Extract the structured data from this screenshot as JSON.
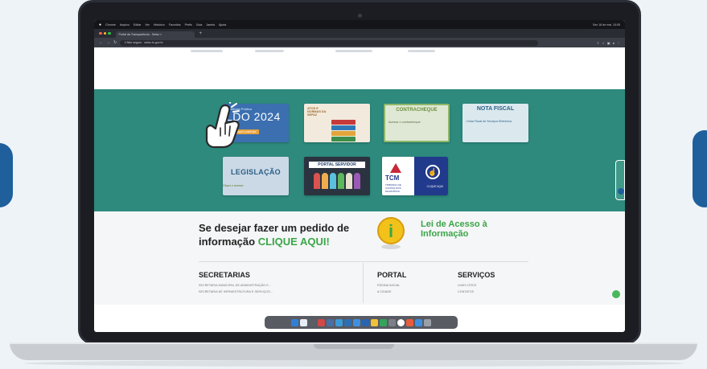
{
  "menubar": {
    "items": [
      "Chrome",
      "Arquivo",
      "Editar",
      "Ver",
      "Histórico",
      "Favoritos",
      "Perfis",
      "Guia",
      "Janela",
      "Ajuda"
    ],
    "clock": "Sex 18 de mai. 10:05"
  },
  "tab": {
    "title": "Portal da Transparência - Sefaz",
    "close": "×"
  },
  "toolbar": {
    "url": "ℹ Não seguro · sefaz.to.gov.br",
    "back": "←",
    "forward": "→",
    "reload": "↻"
  },
  "banners": {
    "ldo": {
      "small": "Audiência Pública",
      "big": "LDO 2024",
      "tag": "Clique aqui e participe"
    },
    "books": {
      "label": "ATOS E NORMAS DA SEFAZ"
    },
    "contracheque": {
      "title": "CONTRACHEQUE",
      "subtitle": "Acesse o contracheque"
    },
    "nota": {
      "title": "NOTA FISCAL",
      "subtitle": "• Nota Fiscal de Serviços Eletrônica"
    },
    "legislacao": {
      "title": "LEGISLAÇÃO",
      "subtitle": "Clique e acesse"
    },
    "servidor": {
      "title": "PORTAL SERVIDOR"
    },
    "tcm": {
      "title": "TCM",
      "subtitle": "TRIBUNAL DE CONTAS DOS MUNICÍPIOS",
      "right": "CLIQUE AQUI",
      "icon": "☝"
    }
  },
  "info": {
    "question": "Se desejar fazer um pedido de informação",
    "cta": "CLIQUE AQUI!",
    "lai": "Lei de Acesso à Informação",
    "lai_glyph": "i"
  },
  "footer": {
    "secretarias": {
      "heading": "SECRETARIAS",
      "items": [
        "SECRETARIA MUNICIPAL DE ADMINISTRAÇÃO E...",
        "SECRETARIA DE INFRAESTRUTURA E SERVIÇOS..."
      ]
    },
    "portal": {
      "heading": "PORTAL",
      "items": [
        "PÁGINA INICIAL",
        "A CIDADE"
      ]
    },
    "servicos": {
      "heading": "SERVIÇOS",
      "items": [
        "LINKS ÚTEIS",
        "CONTATOS"
      ]
    }
  },
  "colors": {
    "teal": "#2d8a7d",
    "accent_green": "#3aa548",
    "brand_blue": "#1f5f9c"
  },
  "icons": [
    "apple-icon",
    "pointing-hand-icon",
    "information-icon",
    "accessibility-icon",
    "chat-icon"
  ]
}
